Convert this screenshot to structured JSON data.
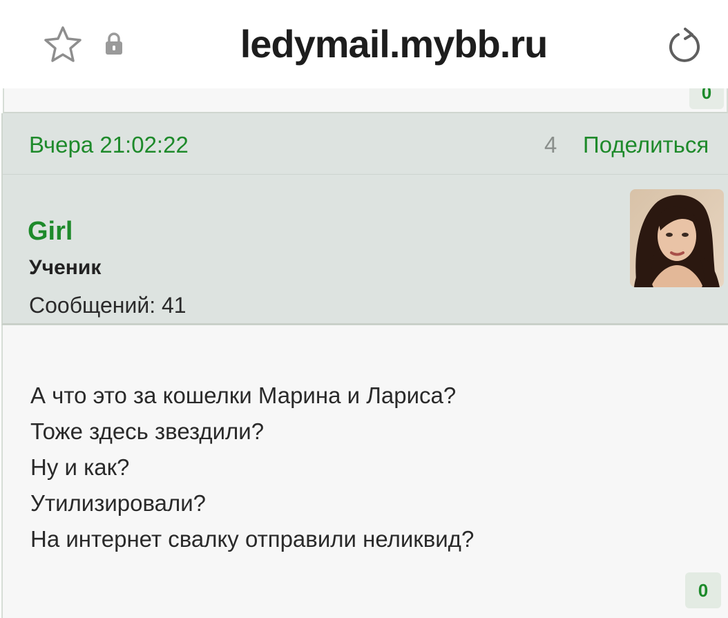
{
  "browser": {
    "url": "ledymail.mybb.ru",
    "icons": [
      "star-icon",
      "lock-icon",
      "reload-icon"
    ]
  },
  "previous_post": {
    "counter": "0"
  },
  "post": {
    "date": "Вчера 21:02:22",
    "number": "4",
    "share_label": "Поделиться",
    "author": {
      "name": "Girl",
      "rank": "Ученик",
      "posts_label": "Сообщений: 41"
    },
    "lines": [
      "А что это за кошелки Марина и Лариса?",
      "Тоже здесь звездили?",
      "Ну и как?",
      "Утилизировали?",
      "На интернет свалку отправили неликвид?"
    ],
    "counter": "0"
  },
  "colors": {
    "accent_green": "#1e8a2b",
    "header_bg": "#dde3e0",
    "body_bg": "#f7f7f7"
  }
}
